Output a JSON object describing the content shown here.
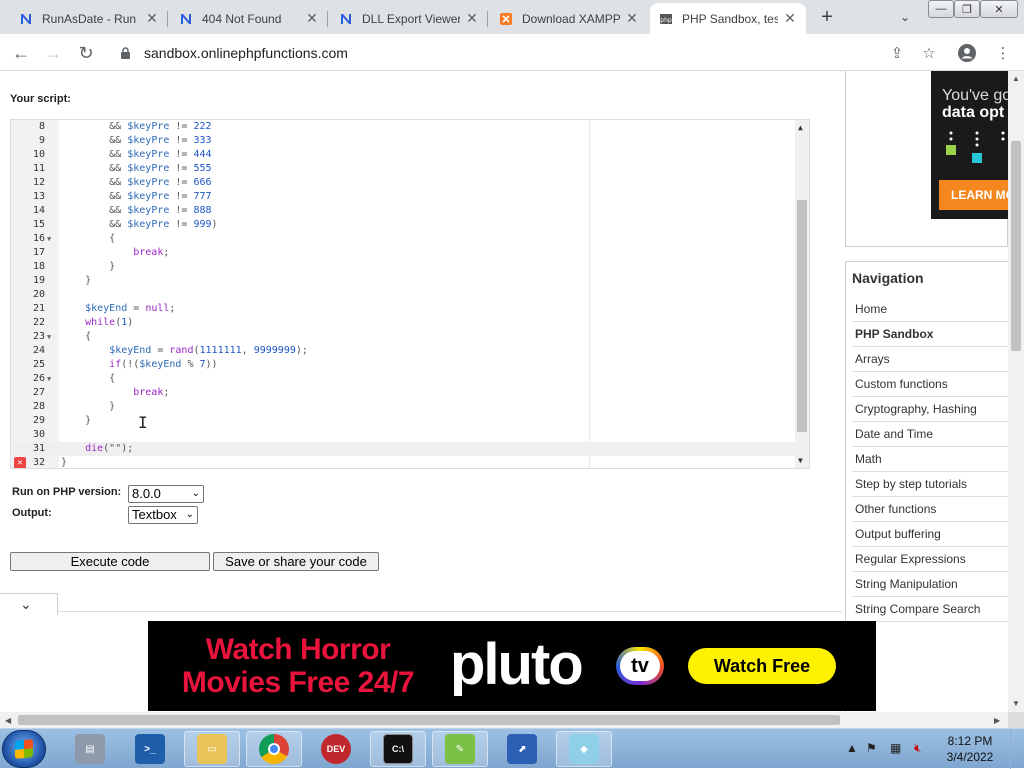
{
  "browser": {
    "tabs": [
      {
        "title": "RunAsDate - Run",
        "icon": "n-icon",
        "active": false
      },
      {
        "title": "404 Not Found",
        "icon": "n-icon",
        "active": false
      },
      {
        "title": "DLL Export Viewer",
        "icon": "n-icon",
        "active": false
      },
      {
        "title": "Download XAMPP",
        "icon": "xampp-icon",
        "active": false
      },
      {
        "title": "PHP Sandbox, test",
        "icon": "php-icon",
        "active": true
      }
    ],
    "new_tab": "+",
    "url": "sandbox.onlinephpfunctions.com"
  },
  "page": {
    "your_script_label": "Your script:",
    "code_lines": [
      {
        "n": "8",
        "text": "        && $keyPre != 222"
      },
      {
        "n": "9",
        "text": "        && $keyPre != 333"
      },
      {
        "n": "10",
        "text": "        && $keyPre != 444"
      },
      {
        "n": "11",
        "text": "        && $keyPre != 555"
      },
      {
        "n": "12",
        "text": "        && $keyPre != 666"
      },
      {
        "n": "13",
        "text": "        && $keyPre != 777"
      },
      {
        "n": "14",
        "text": "        && $keyPre != 888"
      },
      {
        "n": "15",
        "text": "        && $keyPre != 999)"
      },
      {
        "n": "16",
        "text": "        {",
        "fold": true
      },
      {
        "n": "17",
        "text": "            break;"
      },
      {
        "n": "18",
        "text": "        }"
      },
      {
        "n": "19",
        "text": "    }"
      },
      {
        "n": "20",
        "text": ""
      },
      {
        "n": "21",
        "text": "    $keyEnd = null;"
      },
      {
        "n": "22",
        "text": "    while(1)"
      },
      {
        "n": "23",
        "text": "    {",
        "fold": true
      },
      {
        "n": "24",
        "text": "        $keyEnd = rand(1111111, 9999999);"
      },
      {
        "n": "25",
        "text": "        if(!($keyEnd % 7))"
      },
      {
        "n": "26",
        "text": "        {",
        "fold": true
      },
      {
        "n": "27",
        "text": "            break;"
      },
      {
        "n": "28",
        "text": "        }"
      },
      {
        "n": "29",
        "text": "    }"
      },
      {
        "n": "30",
        "text": ""
      },
      {
        "n": "31",
        "text": "    die(\"\");",
        "active": true
      },
      {
        "n": "32",
        "text": "}",
        "error": true
      }
    ],
    "run_on_label": "Run on PHP version:",
    "php_version": "8.0.0",
    "output_label": "Output:",
    "output_type": "Textbox",
    "execute_button": "Execute code",
    "save_button": "Save or share your code",
    "collapse_icon": "chevron-down-icon"
  },
  "sidebar": {
    "ad": {
      "line1": "You've go",
      "line2": "data opt",
      "cta": "LEARN MO"
    },
    "nav_title": "Navigation",
    "nav_items": [
      {
        "label": "Home",
        "active": false
      },
      {
        "label": "PHP Sandbox",
        "active": true
      },
      {
        "label": "Arrays",
        "active": false
      },
      {
        "label": "Custom functions",
        "active": false
      },
      {
        "label": "Cryptography, Hashing",
        "active": false
      },
      {
        "label": "Date and Time",
        "active": false
      },
      {
        "label": "Math",
        "active": false
      },
      {
        "label": "Step by step tutorials",
        "active": false
      },
      {
        "label": "Other functions",
        "active": false
      },
      {
        "label": "Output buffering",
        "active": false
      },
      {
        "label": "Regular Expressions",
        "active": false
      },
      {
        "label": "String Manipulation",
        "active": false
      },
      {
        "label": "String Compare Search",
        "active": false
      }
    ]
  },
  "banner": {
    "headline": "Watch Horror Movies Free 24/7",
    "logo": "pluto",
    "logo_badge": "tv",
    "cta": "Watch Free"
  },
  "taskbar": {
    "time": "8:12 PM",
    "date": "3/4/2022"
  }
}
